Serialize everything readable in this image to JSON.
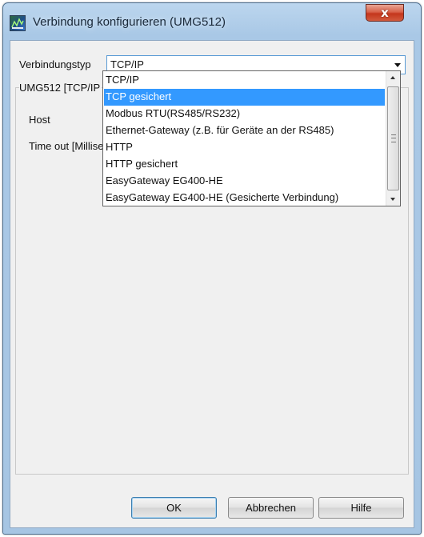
{
  "window": {
    "title": "Verbindung konfigurieren (UMG512)",
    "app_icon": "jasic-app-icon",
    "close_icon": "close-icon",
    "close_symbol": "x"
  },
  "form": {
    "type_label": "Verbindungstyp",
    "type_value": "TCP/IP",
    "group_label": "UMG512 [TCP/IP",
    "host_label": "Host",
    "timeout_label": "Time out [Millise"
  },
  "dropdown": {
    "options": [
      "TCP/IP",
      "TCP gesichert",
      "Modbus RTU(RS485/RS232)",
      "Ethernet-Gateway (z.B. für Geräte an der RS485)",
      "HTTP",
      "HTTP gesichert",
      "EasyGateway EG400-HE",
      "EasyGateway EG400-HE (Gesicherte Verbindung)"
    ],
    "selected_index": 1,
    "highlight_color": "#3399ff"
  },
  "buttons": {
    "ok": "OK",
    "cancel": "Abbrechen",
    "help": "Hilfe"
  }
}
